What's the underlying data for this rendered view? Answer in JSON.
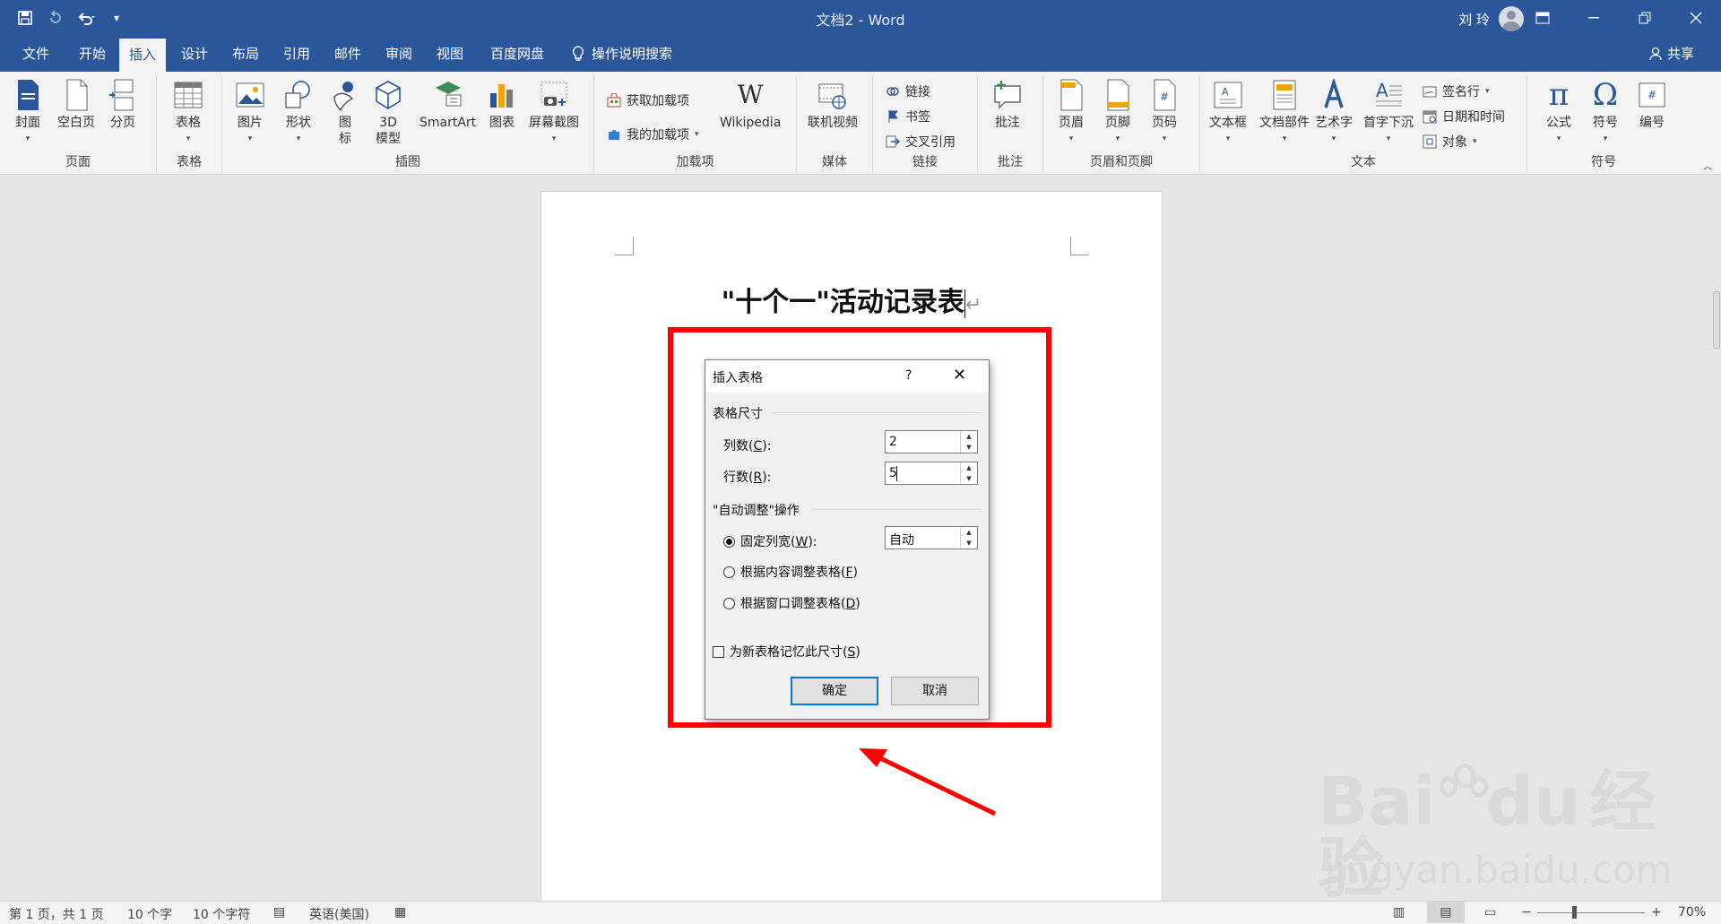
{
  "window": {
    "title": "文档2 - Word",
    "user_name": "刘 玲"
  },
  "quick_access": [
    "save-icon",
    "redo-icon",
    "undo-icon",
    "customize-icon"
  ],
  "tabs": [
    "文件",
    "开始",
    "插入",
    "设计",
    "布局",
    "引用",
    "邮件",
    "审阅",
    "视图",
    "百度网盘"
  ],
  "active_tab": "插入",
  "tell_me": "操作说明搜索",
  "share": "共享",
  "ribbon": {
    "pages": {
      "label": "页面",
      "items": [
        "封面",
        "空白页",
        "分页"
      ]
    },
    "tables": {
      "label": "表格",
      "items": [
        "表格"
      ]
    },
    "illustrations": {
      "label": "插图",
      "pictures": "图片",
      "shapes": "形状",
      "icons_l1": "图",
      "icons_l2": "标",
      "model_l1": "3D",
      "model_l2": "模型",
      "smartart": "SmartArt",
      "chart": "图表",
      "screenshot": "屏幕截图"
    },
    "addins": {
      "label": "加载项",
      "get": "获取加载项",
      "my": "我的加载项",
      "wiki": "Wikipedia"
    },
    "media": {
      "label": "媒体",
      "items": [
        "联机视频"
      ]
    },
    "links": {
      "label": "链接",
      "items": [
        "链接",
        "书签",
        "交叉引用"
      ]
    },
    "comments": {
      "label": "批注",
      "items": [
        "批注"
      ]
    },
    "header_footer": {
      "label": "页眉和页脚",
      "items": [
        "页眉",
        "页脚",
        "页码"
      ]
    },
    "text": {
      "label": "文本",
      "items": [
        "文本框",
        "文档部件",
        "艺术字",
        "首字下沉"
      ],
      "side": [
        "签名行",
        "日期和时间",
        "对象"
      ]
    },
    "symbols": {
      "label": "符号",
      "items": [
        "公式",
        "符号",
        "编号"
      ]
    }
  },
  "document": {
    "heading": "\"十个一\"活动记录表"
  },
  "dialog": {
    "title": "插入表格",
    "help": "?",
    "section_size": "表格尺寸",
    "cols_label": "列数(",
    "cols_key": "C",
    "cols_tail": "):",
    "cols_value": "2",
    "rows_label": "行数(",
    "rows_key": "R",
    "rows_tail": "):",
    "rows_value": "5",
    "section_autofit": "\"自动调整\"操作",
    "fixed_label": "固定列宽(",
    "fixed_key": "W",
    "fixed_tail": "):",
    "fixed_value": "自动",
    "content_label": "根据内容调整表格(",
    "content_key": "F",
    "content_tail": ")",
    "window_label": "根据窗口调整表格(",
    "window_key": "D",
    "window_tail": ")",
    "remember_label": "为新表格记忆此尺寸(",
    "remember_key": "S",
    "remember_tail": ")",
    "ok": "确定",
    "cancel": "取消"
  },
  "status": {
    "page": "第 1 页，共 1 页",
    "words": "10 个字",
    "chars": "10 个字符",
    "lang": "英语(美国)",
    "zoom": "70%"
  },
  "watermark": {
    "brand_a": "Bai",
    "brand_b": "du",
    "brand_cn": "经验",
    "url": "jingyan.baidu.com"
  },
  "colors": {
    "accent": "#2b579a",
    "highlight": "#ff0000",
    "focus": "#0078d7"
  }
}
